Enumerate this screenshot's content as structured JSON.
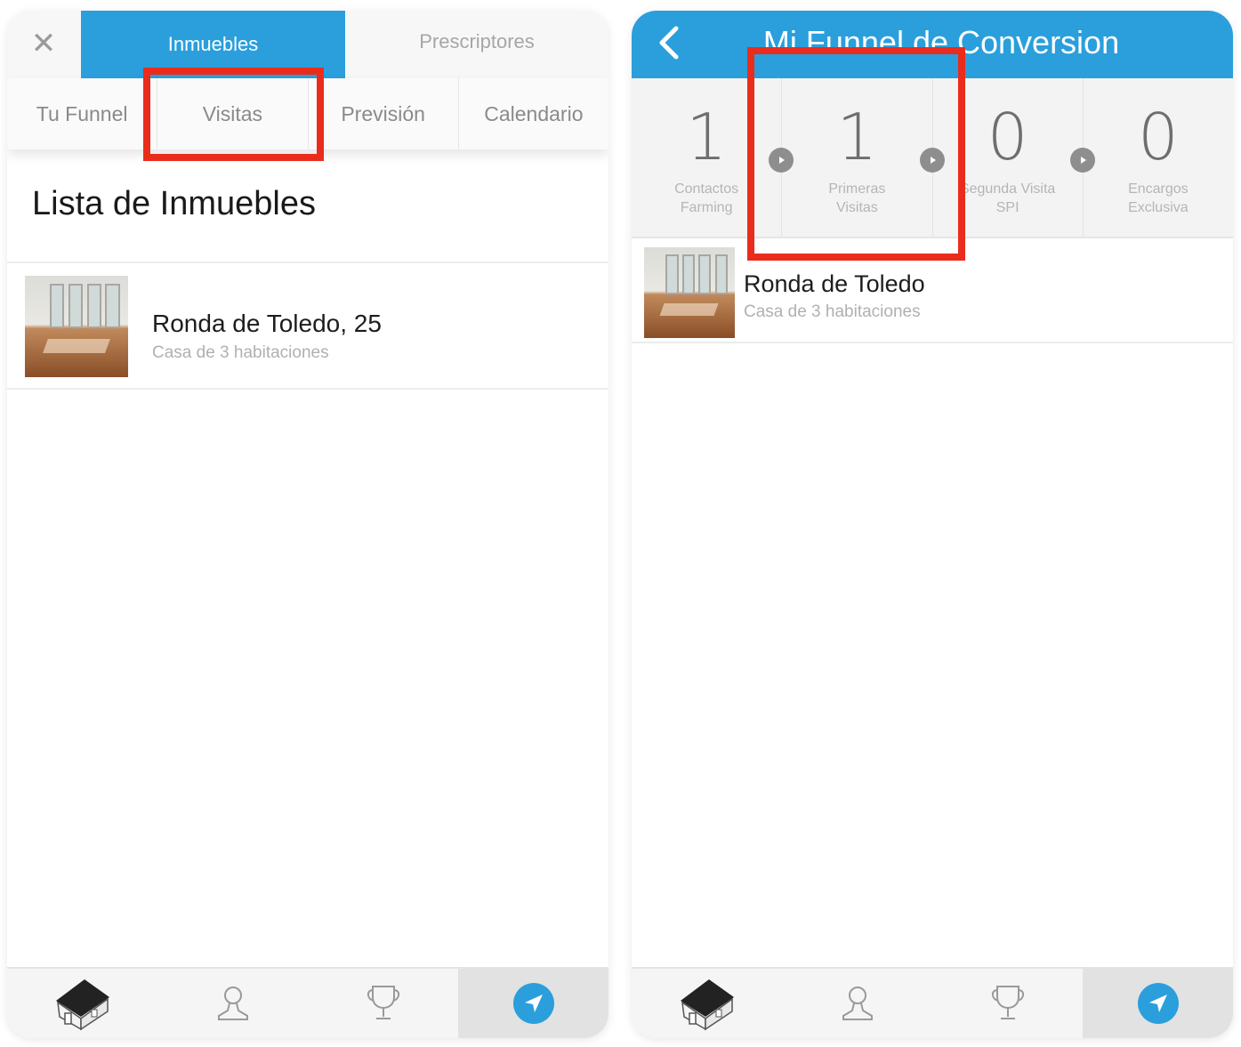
{
  "left_screen": {
    "top_tabs": {
      "close_glyph": "✕",
      "inmuebles": "Inmuebles",
      "prescriptores": "Prescriptores"
    },
    "sub_tabs": [
      "Tu Funnel",
      "Visitas",
      "Previsión",
      "Calendario"
    ],
    "section_title": "Lista de Inmuebles",
    "list": [
      {
        "title": "Ronda de Toledo, 25",
        "subtitle": "Casa de 3 habitaciones"
      }
    ],
    "bottom_bar": [
      "home-icon",
      "user-icon",
      "trophy-icon",
      "navigation-icon"
    ],
    "active_bottom_index": 3
  },
  "right_screen": {
    "header": {
      "back_glyph": "‹",
      "title": "Mi Funnel de Conversion"
    },
    "stats": [
      {
        "value": "1",
        "label_line1": "Contactos",
        "label_line2": "Farming"
      },
      {
        "value": "1",
        "label_line1": "Primeras",
        "label_line2": "Visitas"
      },
      {
        "value": "0",
        "label_line1": "Segunda Visita",
        "label_line2": "SPI"
      },
      {
        "value": "0",
        "label_line1": "Encargos",
        "label_line2": "Exclusiva"
      }
    ],
    "list": [
      {
        "title": "Ronda de Toledo",
        "subtitle": "Casa de 3 habitaciones"
      }
    ],
    "bottom_bar": [
      "home-icon",
      "user-icon",
      "trophy-icon",
      "navigation-icon"
    ],
    "active_bottom_index": 3
  },
  "colors": {
    "accent": "#2a9fdc",
    "highlight": "#ea2c1c",
    "muted_text": "#b0b0b0"
  }
}
